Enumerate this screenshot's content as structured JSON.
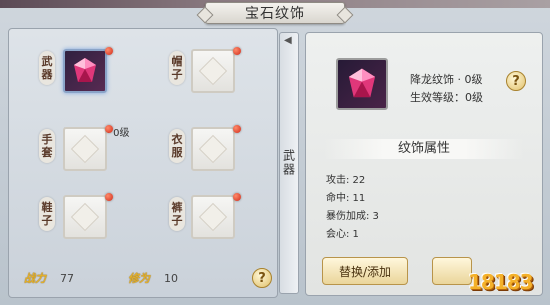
{
  "header": {
    "title": "宝石纹饰"
  },
  "slots": [
    {
      "label": "武器",
      "equipped": true,
      "caption": "降龙纹饰 · 0级"
    },
    {
      "label": "帽子",
      "equipped": false
    },
    {
      "label": "手套",
      "equipped": false
    },
    {
      "label": "衣服",
      "equipped": false
    },
    {
      "label": "鞋子",
      "equipped": false
    },
    {
      "label": "裤子",
      "equipped": false
    }
  ],
  "stats": {
    "power_label": "战力",
    "power_value": "77",
    "cultivation_label": "修为",
    "cultivation_value": "10"
  },
  "help_symbol": "?",
  "category_tab": {
    "label": "武器"
  },
  "detail": {
    "name": "降龙纹饰 · 0级",
    "effect_level": "生效等级：0级",
    "section_title": "纹饰属性",
    "attributes": [
      "攻击: 22",
      "命中: 11",
      "暴伤加成: 3",
      "会心: 1"
    ],
    "action_label": "替换/添加"
  },
  "colors": {
    "accent_gold": "#e3b02a",
    "notify_red": "#d02b1a",
    "gem_pink": "#e0377a"
  },
  "watermark": "18183"
}
